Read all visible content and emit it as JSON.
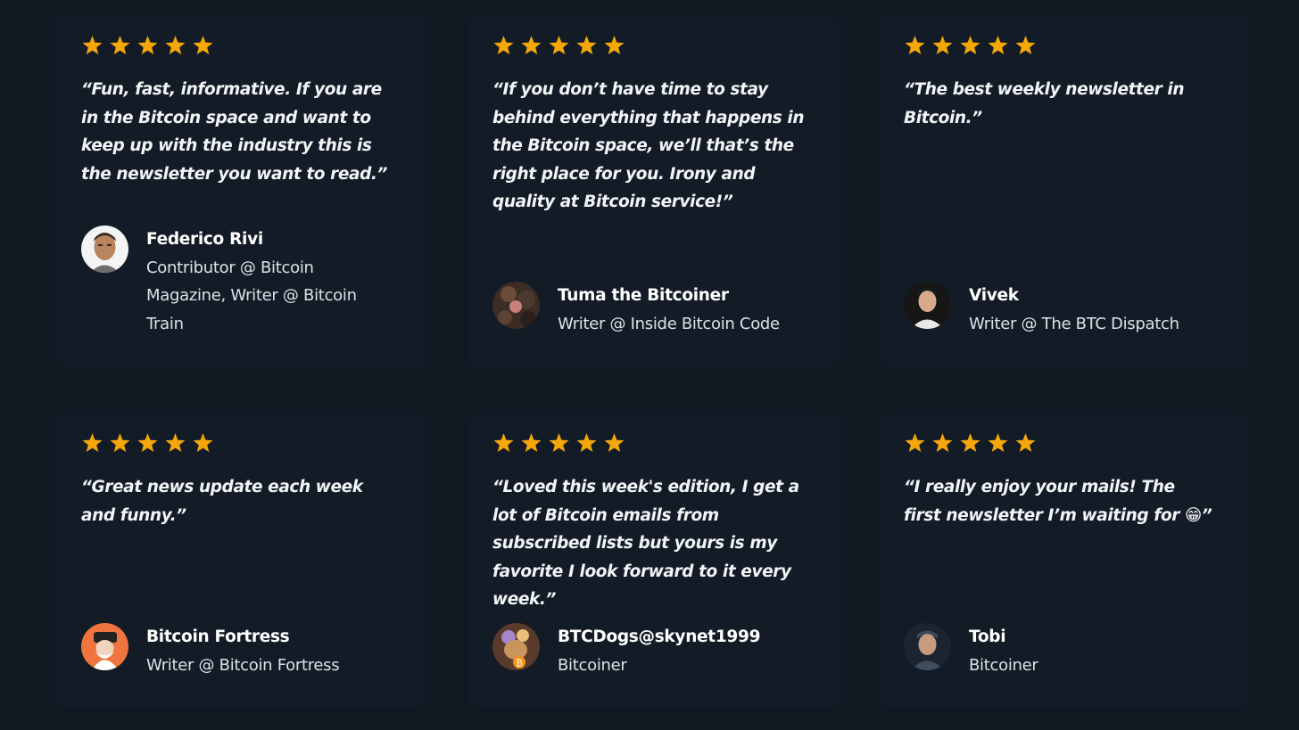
{
  "colors": {
    "background": "#111922",
    "card": "#131c26",
    "star": "#f5a70a",
    "text": "#f2f4f7"
  },
  "testimonials": [
    {
      "rating": 5,
      "quote": "“Fun, fast, informative. If you are in the Bitcoin space and want to keep up with the industry this is the newsletter you want to read.”",
      "name": "Federico Rivi",
      "role": "Contributor @ Bitcoin Magazine, Writer @ Bitcoin Train"
    },
    {
      "rating": 5,
      "quote": "“If you don’t have time to stay behind everything that happens in the Bitcoin space, we’ll that’s the right place for you. Irony and quality at Bitcoin service!”",
      "name": "Tuma the Bitcoiner",
      "role": "Writer @ Inside Bitcoin Code"
    },
    {
      "rating": 5,
      "quote": "“The best weekly newsletter in Bitcoin.”",
      "name": "Vivek",
      "role": "Writer @ The BTC Dispatch"
    },
    {
      "rating": 5,
      "quote": "“Great news update each week and funny.”",
      "name": "Bitcoin Fortress",
      "role": "Writer @ Bitcoin Fortress"
    },
    {
      "rating": 5,
      "quote": "“Loved this week's edition, I get a lot of Bitcoin emails from subscribed lists but yours is my favorite I look forward to it every week.”",
      "name": "BTCDogs@skynet1999",
      "role": "Bitcoiner"
    },
    {
      "rating": 5,
      "quote": "“I really enjoy your mails! The first newsletter I’m waiting for 😁”",
      "name": "Tobi",
      "role": "Bitcoiner"
    }
  ]
}
